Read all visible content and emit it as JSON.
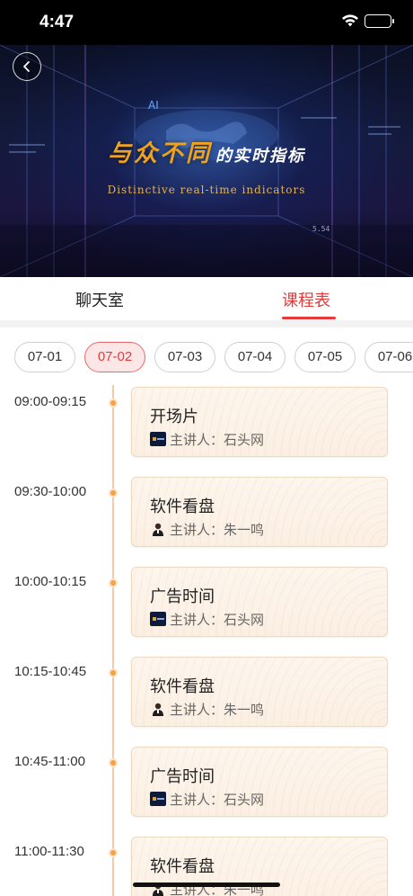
{
  "status_bar": {
    "time": "4:47"
  },
  "banner": {
    "headline_strong": "与众不同",
    "headline_rest": "的实时指标",
    "subhead": "Distinctive real-time indicators",
    "ai_label": "AI",
    "readout": "5.54"
  },
  "tabs": [
    {
      "label": "聊天室",
      "active": false
    },
    {
      "label": "课程表",
      "active": true
    }
  ],
  "dates": [
    {
      "label": "07-01",
      "active": false
    },
    {
      "label": "07-02",
      "active": true
    },
    {
      "label": "07-03",
      "active": false
    },
    {
      "label": "07-04",
      "active": false
    },
    {
      "label": "07-05",
      "active": false
    },
    {
      "label": "07-06",
      "active": false
    }
  ],
  "speaker_prefix": "主讲人：",
  "schedule": [
    {
      "time": "09:00-09:15",
      "title": "开场片",
      "speaker": "石头网",
      "avatar": "logo-avatar"
    },
    {
      "time": "09:30-10:00",
      "title": "软件看盘",
      "speaker": "朱一鸣",
      "avatar": "person-avatar"
    },
    {
      "time": "10:00-10:15",
      "title": "广告时间",
      "speaker": "石头网",
      "avatar": "logo-avatar"
    },
    {
      "time": "10:15-10:45",
      "title": "软件看盘",
      "speaker": "朱一鸣",
      "avatar": "person-avatar"
    },
    {
      "time": "10:45-11:00",
      "title": "广告时间",
      "speaker": "石头网",
      "avatar": "logo-avatar"
    },
    {
      "time": "11:00-11:30",
      "title": "软件看盘",
      "speaker": "朱一鸣",
      "avatar": "person-avatar"
    }
  ],
  "colors": {
    "accent": "#e83a3a",
    "timeline_dot": "#f7a144",
    "headline": "#f0a21c"
  }
}
